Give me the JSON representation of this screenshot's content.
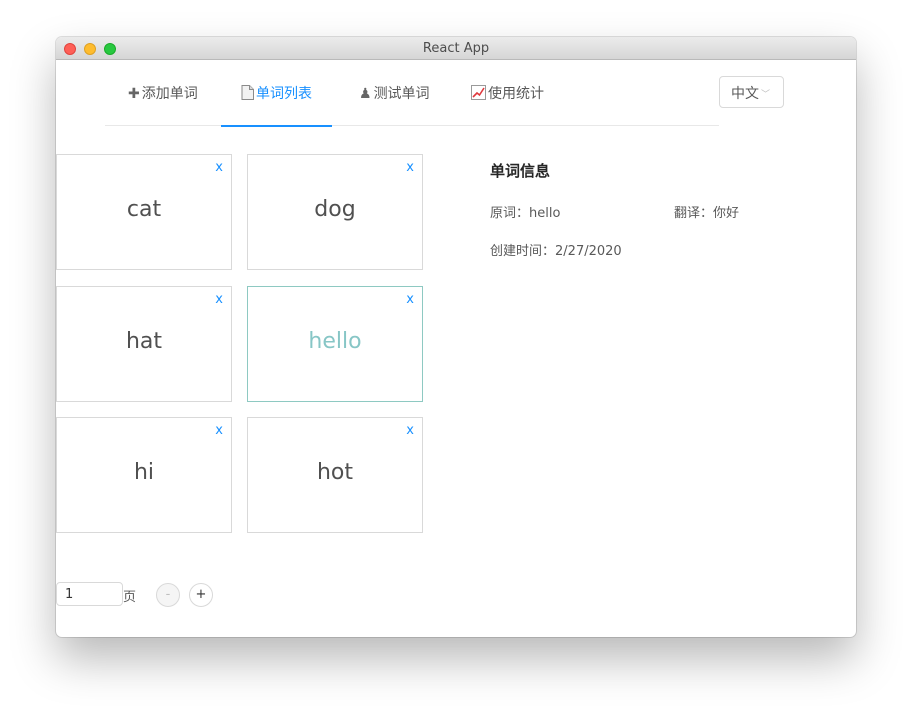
{
  "window": {
    "title": "React App"
  },
  "nav": {
    "tabs": [
      {
        "icon": "plus-icon",
        "label": "添加单词"
      },
      {
        "icon": "document-icon",
        "label": "单词列表"
      },
      {
        "icon": "chess-pawn-icon",
        "label": "测试单词"
      },
      {
        "icon": "chart-increasing-icon",
        "label": "使用统计"
      }
    ],
    "active_tab": 1
  },
  "language": {
    "selected": "中文"
  },
  "words": {
    "delete_label": "x",
    "items": [
      "cat",
      "dog",
      "hat",
      "hello",
      "hi",
      "hot"
    ],
    "selected": "hello"
  },
  "detail": {
    "heading": "单词信息",
    "original_label": "原词：",
    "original_value": "hello",
    "translation_label": "翻译：",
    "translation_value": "你好",
    "created_label": "创建时间：",
    "created_value": "2/27/2020"
  },
  "pager": {
    "page_value": "1",
    "unit": "页",
    "prev_label": "-",
    "next_label": "+"
  },
  "colors": {
    "accent": "#1890ff",
    "selected_word": "#87c6c6"
  }
}
